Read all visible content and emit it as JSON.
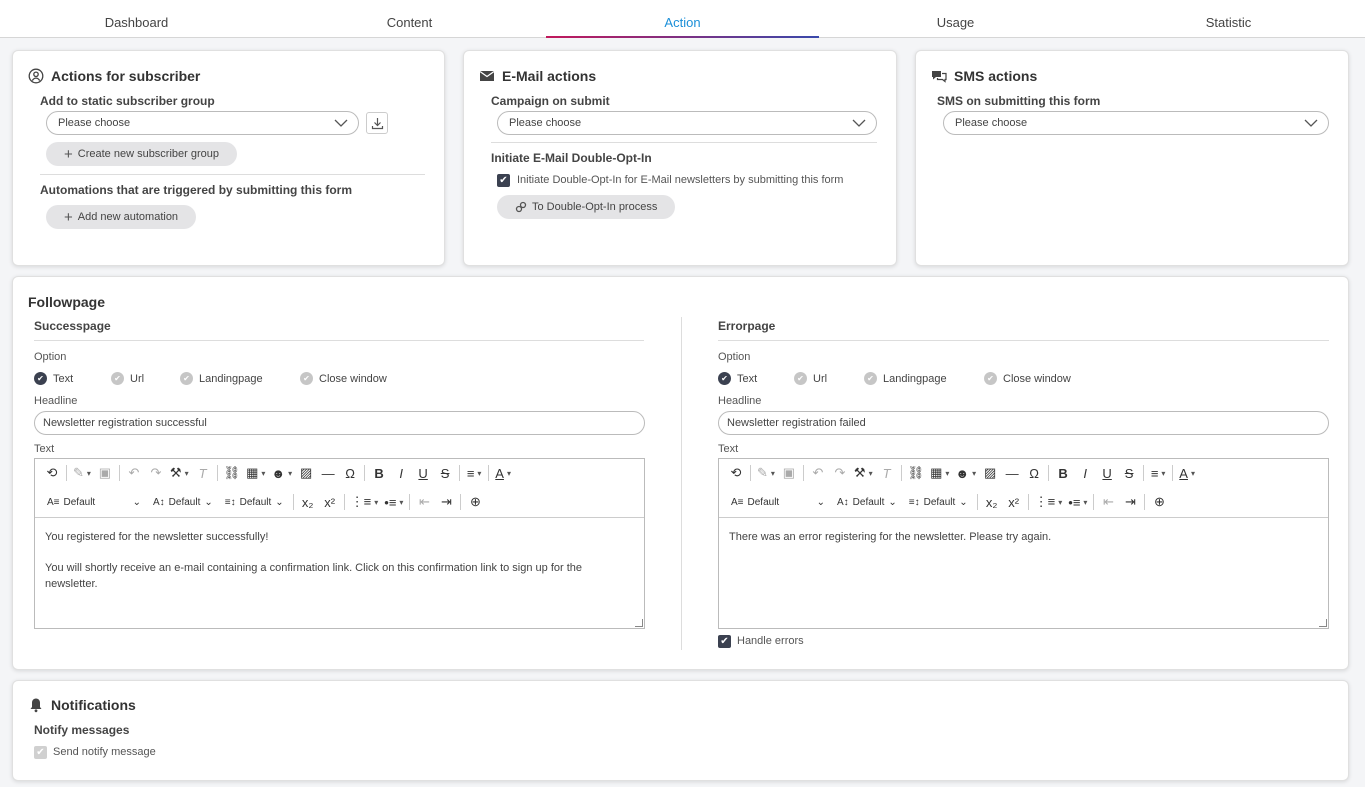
{
  "tabs": [
    "Dashboard",
    "Content",
    "Action",
    "Usage",
    "Statistic"
  ],
  "active_tab": "Action",
  "accent_colors": {
    "active_tab_text": "#1b8fd8",
    "underline_start": "#c2185b",
    "underline_end": "#3949ab"
  },
  "subscriber": {
    "title": "Actions for subscriber",
    "group_label": "Add to static subscriber group",
    "group_select": "Please choose",
    "create_group": "Create new subscriber group",
    "automations_label": "Automations that are triggered by submitting this form",
    "add_automation": "Add new automation"
  },
  "email": {
    "title": "E-Mail actions",
    "campaign_label": "Campaign on submit",
    "campaign_select": "Please choose",
    "doi_label": "Initiate E-Mail Double-Opt-In",
    "doi_checkbox": "Initiate Double-Opt-In for E-Mail newsletters by submitting this form",
    "doi_button": "To Double-Opt-In process"
  },
  "sms": {
    "title": "SMS actions",
    "sms_label": "SMS on submitting this form",
    "sms_select": "Please choose"
  },
  "followpage": {
    "title": "Followpage",
    "success": {
      "title": "Successpage",
      "option_label": "Option",
      "options": [
        "Text",
        "Url",
        "Landingpage",
        "Close window"
      ],
      "selected": "Text",
      "headline_label": "Headline",
      "headline": "Newsletter registration successful",
      "text_label": "Text",
      "font_select": "Default",
      "size_select": "Default",
      "line_select": "Default",
      "paragraph1": "You registered for the newsletter successfully!",
      "paragraph2": "You will shortly receive an e-mail containing a confirmation link. Click on this confirmation link to sign up for the newsletter."
    },
    "error": {
      "title": "Errorpage",
      "option_label": "Option",
      "options": [
        "Text",
        "Url",
        "Landingpage",
        "Close window"
      ],
      "selected": "Text",
      "headline_label": "Headline",
      "headline": "Newsletter registration failed",
      "text_label": "Text",
      "font_select": "Default",
      "size_select": "Default",
      "line_select": "Default",
      "paragraph1": "There was an error registering for the newsletter. Please try again.",
      "handle_errors": "Handle errors"
    }
  },
  "notifications": {
    "title": "Notifications",
    "subtitle": "Notify messages",
    "send_label": "Send notify message"
  }
}
